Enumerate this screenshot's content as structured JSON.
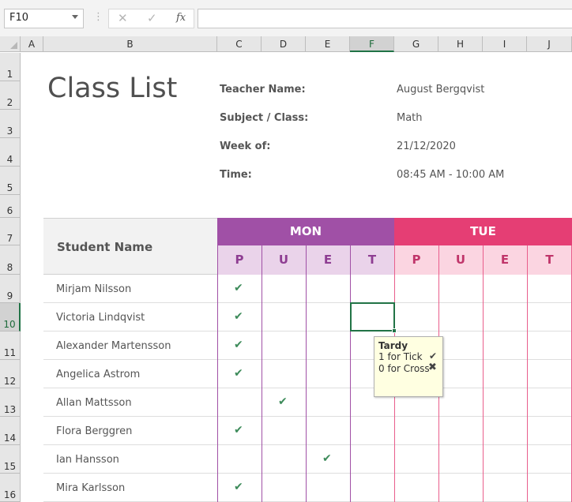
{
  "formula_bar": {
    "name_box": "F10",
    "cancel_icon": "✕",
    "enter_icon": "✓",
    "fx_label": "fx",
    "formula": ""
  },
  "columns": [
    "A",
    "B",
    "C",
    "D",
    "E",
    "F",
    "G",
    "H",
    "I",
    "J"
  ],
  "selected_column": "F",
  "rows": [
    "1",
    "2",
    "3",
    "4",
    "5",
    "6",
    "7",
    "8",
    "9",
    "10",
    "11",
    "12",
    "13",
    "14",
    "15",
    "16"
  ],
  "selected_row": "10",
  "sheet": {
    "title": "Class List",
    "info": [
      {
        "label": "Teacher Name:",
        "value": "August Bergqvist"
      },
      {
        "label": "Subject / Class:",
        "value": "Math"
      },
      {
        "label": "Week of:",
        "value": "21/12/2020"
      },
      {
        "label": "Time:",
        "value": "08:45 AM - 10:00 AM"
      }
    ],
    "student_header": "Student Name",
    "days": [
      {
        "name": "MON",
        "color": "#a050a6",
        "codes": [
          "P",
          "U",
          "E",
          "T"
        ]
      },
      {
        "name": "TUE",
        "color": "#e53e74",
        "codes": [
          "P",
          "U",
          "E",
          "T"
        ]
      }
    ],
    "students": [
      {
        "name": "Mirjam Nilsson",
        "mark": "P"
      },
      {
        "name": "Victoria Lindqvist",
        "mark": "P"
      },
      {
        "name": "Alexander Martensson",
        "mark": "P"
      },
      {
        "name": "Angelica Astrom",
        "mark": "P"
      },
      {
        "name": "Allan Mattsson",
        "mark": "U"
      },
      {
        "name": "Flora Berggren",
        "mark": "P"
      },
      {
        "name": "Ian Hansson",
        "mark": "E"
      },
      {
        "name": "Mira Karlsson",
        "mark": "P"
      }
    ],
    "tick_glyph": "✔"
  },
  "tooltip": {
    "title": "Tardy",
    "line1": "1 for Tick",
    "line2": "0 for Cross",
    "tick_glyph": "✔",
    "cross_glyph": "✖"
  }
}
